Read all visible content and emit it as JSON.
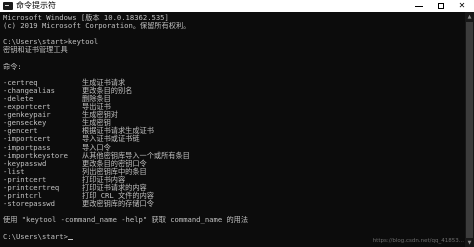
{
  "window": {
    "title": "命令提示符",
    "minimize_glyph": "",
    "close_glyph": "✕"
  },
  "console": {
    "header_lines": [
      "Microsoft Windows [版本 10.0.18362.535]",
      "(c) 2019 Microsoft Corporation。保留所有权利。"
    ],
    "prompt_command": "C:\\Users\\start>keytool",
    "tool_description": "密钥和证书管理工具",
    "commands_heading": "命令:",
    "commands": [
      {
        "name": "-certreq",
        "desc": "生成证书请求"
      },
      {
        "name": "-changealias",
        "desc": "更改条目的别名"
      },
      {
        "name": "-delete",
        "desc": "删除条目"
      },
      {
        "name": "-exportcert",
        "desc": "导出证书"
      },
      {
        "name": "-genkeypair",
        "desc": "生成密钥对"
      },
      {
        "name": "-genseckey",
        "desc": "生成密钥"
      },
      {
        "name": "-gencert",
        "desc": "根据证书请求生成证书"
      },
      {
        "name": "-importcert",
        "desc": "导入证书或证书链"
      },
      {
        "name": "-importpass",
        "desc": "导入口令"
      },
      {
        "name": "-importkeystore",
        "desc": "从其他密钥库导入一个或所有条目"
      },
      {
        "name": "-keypasswd",
        "desc": "更改条目的密钥口令"
      },
      {
        "name": "-list",
        "desc": "列出密钥库中的条目"
      },
      {
        "name": "-printcert",
        "desc": "打印证书内容"
      },
      {
        "name": "-printcertreq",
        "desc": "打印证书请求的内容"
      },
      {
        "name": "-printcrl",
        "desc": "打印 CRL 文件的内容"
      },
      {
        "name": "-storepasswd",
        "desc": "更改密钥库的存储口令"
      }
    ],
    "usage_hint": "使用 \"keytool -command_name -help\" 获取 command_name 的用法",
    "final_prompt": "C:\\Users\\start>"
  },
  "watermark": "https://blog.csdn.net/qq_41853..."
}
